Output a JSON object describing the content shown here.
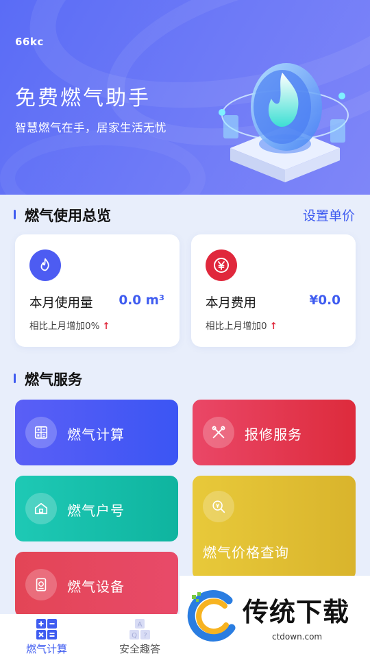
{
  "hero": {
    "brand": "66kc",
    "title": "免费燃气助手",
    "subtitle": "智慧燃气在手，居家生活无忧"
  },
  "overview": {
    "section_title": "燃气使用总览",
    "set_price_link": "设置单价",
    "cards": [
      {
        "icon": "flame-icon",
        "label": "本月使用量",
        "value": "0.0 m³",
        "compare": "相比上月增加0%",
        "trend": "↑",
        "accent": "#4d5cf2"
      },
      {
        "icon": "yen-icon",
        "label": "本月费用",
        "value": "¥0.0",
        "compare": "相比上月增加0",
        "trend": "↑",
        "accent": "#e0283c"
      }
    ]
  },
  "services": {
    "section_title": "燃气服务",
    "tiles": [
      {
        "label": "燃气计算",
        "icon": "calculator-icon"
      },
      {
        "label": "报修服务",
        "icon": "repair-tools-icon"
      },
      {
        "label": "燃气户号",
        "icon": "home-icon"
      },
      {
        "label": "燃气价格查询",
        "icon": "price-search-icon"
      },
      {
        "label": "燃气设备",
        "icon": "gas-meter-icon"
      }
    ]
  },
  "bottom_nav": {
    "items": [
      {
        "label": "燃气计算",
        "icon": "calculator-grid-icon",
        "active": true
      },
      {
        "label": "安全趣答",
        "icon": "quiz-blocks-icon",
        "active": false
      }
    ],
    "active_color": "#3f5cf0",
    "inactive_color": "#555555"
  },
  "watermark": {
    "text": "传统下载",
    "url": "ctdown.com"
  }
}
